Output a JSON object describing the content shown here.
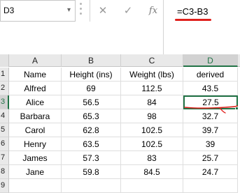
{
  "name_box": {
    "value": "D3"
  },
  "formula_bar": {
    "cancel_icon": "✕",
    "enter_icon": "✓",
    "function_icon": "fx",
    "formula": "=C3-B3"
  },
  "columns": [
    "A",
    "B",
    "C",
    "D"
  ],
  "rows": [
    {
      "num": "1",
      "cells": [
        "Name",
        "Height (ins)",
        "Weight (lbs)",
        "derived"
      ]
    },
    {
      "num": "2",
      "cells": [
        "Alfred",
        "69",
        "112.5",
        "43.5"
      ]
    },
    {
      "num": "3",
      "cells": [
        "Alice",
        "56.5",
        "84",
        "27.5"
      ]
    },
    {
      "num": "4",
      "cells": [
        "Barbara",
        "65.3",
        "98",
        "32.7"
      ]
    },
    {
      "num": "5",
      "cells": [
        "Carol",
        "62.8",
        "102.5",
        "39.7"
      ]
    },
    {
      "num": "6",
      "cells": [
        "Henry",
        "63.5",
        "102.5",
        "39"
      ]
    },
    {
      "num": "7",
      "cells": [
        "James",
        "57.3",
        "83",
        "25.7"
      ]
    },
    {
      "num": "8",
      "cells": [
        "Jane",
        "59.8",
        "84.5",
        "24.7"
      ]
    },
    {
      "num": "9",
      "cells": [
        "",
        "",
        "",
        ""
      ]
    }
  ],
  "selection": {
    "cell": "D3",
    "border_color": "#217346"
  },
  "annotation_color": "#e0201c"
}
